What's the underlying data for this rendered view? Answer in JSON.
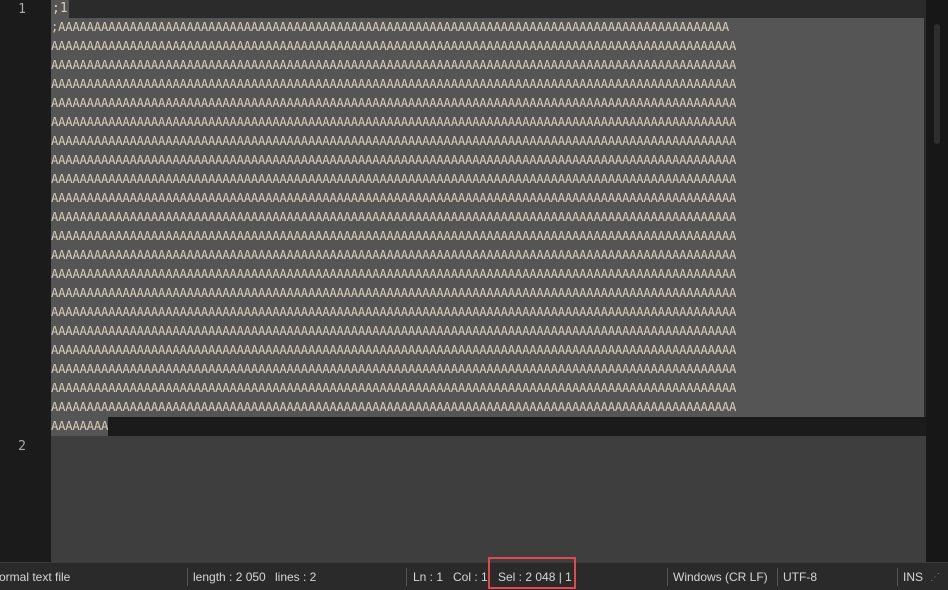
{
  "editor": {
    "gutter": {
      "line1_number": "1",
      "line2_number": "2"
    },
    "line1_first_visual": ";1",
    "wrap_rows": [
      ";AAAAAAAAAAAAAAAAAAAAAAAAAAAAAAAAAAAAAAAAAAAAAAAAAAAAAAAAAAAAAAAAAAAAAAAAAAAAAAAAAAAAAAAAAAAAAA",
      "AAAAAAAAAAAAAAAAAAAAAAAAAAAAAAAAAAAAAAAAAAAAAAAAAAAAAAAAAAAAAAAAAAAAAAAAAAAAAAAAAAAAAAAAAAAAAAAA",
      "AAAAAAAAAAAAAAAAAAAAAAAAAAAAAAAAAAAAAAAAAAAAAAAAAAAAAAAAAAAAAAAAAAAAAAAAAAAAAAAAAAAAAAAAAAAAAAAA",
      "AAAAAAAAAAAAAAAAAAAAAAAAAAAAAAAAAAAAAAAAAAAAAAAAAAAAAAAAAAAAAAAAAAAAAAAAAAAAAAAAAAAAAAAAAAAAAAAA",
      "AAAAAAAAAAAAAAAAAAAAAAAAAAAAAAAAAAAAAAAAAAAAAAAAAAAAAAAAAAAAAAAAAAAAAAAAAAAAAAAAAAAAAAAAAAAAAAAA",
      "AAAAAAAAAAAAAAAAAAAAAAAAAAAAAAAAAAAAAAAAAAAAAAAAAAAAAAAAAAAAAAAAAAAAAAAAAAAAAAAAAAAAAAAAAAAAAAAA",
      "AAAAAAAAAAAAAAAAAAAAAAAAAAAAAAAAAAAAAAAAAAAAAAAAAAAAAAAAAAAAAAAAAAAAAAAAAAAAAAAAAAAAAAAAAAAAAAAA",
      "AAAAAAAAAAAAAAAAAAAAAAAAAAAAAAAAAAAAAAAAAAAAAAAAAAAAAAAAAAAAAAAAAAAAAAAAAAAAAAAAAAAAAAAAAAAAAAAA",
      "AAAAAAAAAAAAAAAAAAAAAAAAAAAAAAAAAAAAAAAAAAAAAAAAAAAAAAAAAAAAAAAAAAAAAAAAAAAAAAAAAAAAAAAAAAAAAAAA",
      "AAAAAAAAAAAAAAAAAAAAAAAAAAAAAAAAAAAAAAAAAAAAAAAAAAAAAAAAAAAAAAAAAAAAAAAAAAAAAAAAAAAAAAAAAAAAAAAA",
      "AAAAAAAAAAAAAAAAAAAAAAAAAAAAAAAAAAAAAAAAAAAAAAAAAAAAAAAAAAAAAAAAAAAAAAAAAAAAAAAAAAAAAAAAAAAAAAAA",
      "AAAAAAAAAAAAAAAAAAAAAAAAAAAAAAAAAAAAAAAAAAAAAAAAAAAAAAAAAAAAAAAAAAAAAAAAAAAAAAAAAAAAAAAAAAAAAAAA",
      "AAAAAAAAAAAAAAAAAAAAAAAAAAAAAAAAAAAAAAAAAAAAAAAAAAAAAAAAAAAAAAAAAAAAAAAAAAAAAAAAAAAAAAAAAAAAAAAA",
      "AAAAAAAAAAAAAAAAAAAAAAAAAAAAAAAAAAAAAAAAAAAAAAAAAAAAAAAAAAAAAAAAAAAAAAAAAAAAAAAAAAAAAAAAAAAAAAAA",
      "AAAAAAAAAAAAAAAAAAAAAAAAAAAAAAAAAAAAAAAAAAAAAAAAAAAAAAAAAAAAAAAAAAAAAAAAAAAAAAAAAAAAAAAAAAAAAAAA",
      "AAAAAAAAAAAAAAAAAAAAAAAAAAAAAAAAAAAAAAAAAAAAAAAAAAAAAAAAAAAAAAAAAAAAAAAAAAAAAAAAAAAAAAAAAAAAAAAA",
      "AAAAAAAAAAAAAAAAAAAAAAAAAAAAAAAAAAAAAAAAAAAAAAAAAAAAAAAAAAAAAAAAAAAAAAAAAAAAAAAAAAAAAAAAAAAAAAAA",
      "AAAAAAAAAAAAAAAAAAAAAAAAAAAAAAAAAAAAAAAAAAAAAAAAAAAAAAAAAAAAAAAAAAAAAAAAAAAAAAAAAAAAAAAAAAAAAAAA",
      "AAAAAAAAAAAAAAAAAAAAAAAAAAAAAAAAAAAAAAAAAAAAAAAAAAAAAAAAAAAAAAAAAAAAAAAAAAAAAAAAAAAAAAAAAAAAAAAA",
      "AAAAAAAAAAAAAAAAAAAAAAAAAAAAAAAAAAAAAAAAAAAAAAAAAAAAAAAAAAAAAAAAAAAAAAAAAAAAAAAAAAAAAAAAAAAAAAAA",
      "AAAAAAAAAAAAAAAAAAAAAAAAAAAAAAAAAAAAAAAAAAAAAAAAAAAAAAAAAAAAAAAAAAAAAAAAAAAAAAAAAAAAAAAAAAAAAAAA"
    ],
    "tail_row": "AAAAAAAA"
  },
  "statusbar": {
    "file_type": "ormal text file",
    "length": "length : 2 050",
    "lines": "lines : 2",
    "ln": "Ln : 1",
    "col": "Col : 1",
    "sel": "Sel : 2 048 | 1",
    "eol": "Windows (CR LF)",
    "encoding": "UTF-8",
    "insert_mode": "INS",
    "grip_icon": "resize-grip-icon"
  },
  "colors": {
    "editor_bg": "#2b2b2b",
    "selection_bg": "#555555",
    "text": "#d8cfb8",
    "highlight_box": "#e04a4a",
    "statusbar_bg": "#2a2a2a"
  }
}
